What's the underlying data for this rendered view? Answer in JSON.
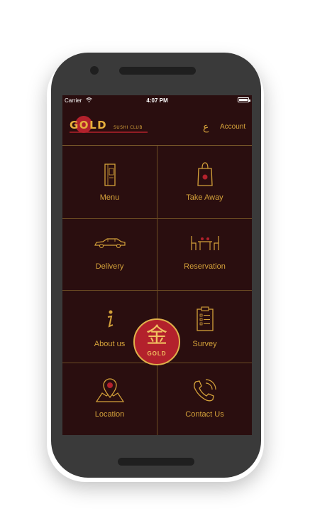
{
  "status_bar": {
    "carrier": "Carrier",
    "time": "4:07 PM"
  },
  "header": {
    "logo_text": "GOLD",
    "logo_subtext": "SUSHI CLUB",
    "language_toggle": "ع",
    "account_label": "Account"
  },
  "menu": {
    "menu": "Menu",
    "take_away": "Take Away",
    "delivery": "Delivery",
    "reservation": "Reservation",
    "about_us": "About us",
    "survey": "Survey",
    "location": "Location",
    "contact_us": "Contact Us"
  },
  "emblem": {
    "char": "金",
    "text": "GOLD"
  },
  "colors": {
    "background": "#2a0e0f",
    "accent": "#d4a13a",
    "emblem_red": "#b3212c",
    "device": "#3a3a3a"
  }
}
